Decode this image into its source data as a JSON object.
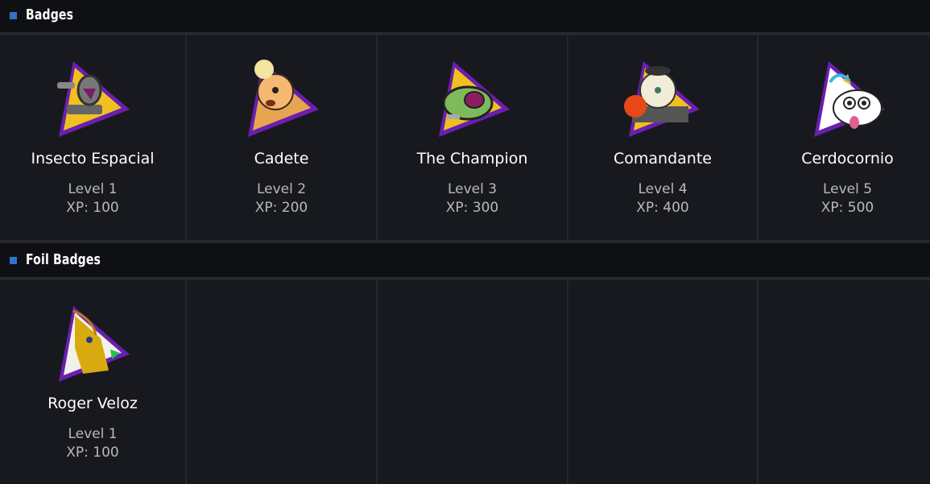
{
  "sections": [
    {
      "title": "Badges",
      "badges": [
        {
          "name": "Insecto Espacial",
          "level": "Level 1",
          "xp": "XP: 100",
          "icon": "alien-bug-badge-icon"
        },
        {
          "name": "Cadete",
          "level": "Level 2",
          "xp": "XP: 200",
          "icon": "pony-cadet-badge-icon"
        },
        {
          "name": "The Champion",
          "level": "Level 3",
          "xp": "XP: 300",
          "icon": "robot-head-badge-icon"
        },
        {
          "name": "Comandante",
          "level": "Level 4",
          "xp": "XP: 400",
          "icon": "pony-commander-badge-icon"
        },
        {
          "name": "Cerdocornio",
          "level": "Level 5",
          "xp": "XP: 500",
          "icon": "unicorn-pig-badge-icon"
        }
      ]
    },
    {
      "title": "Foil Badges",
      "badges": [
        {
          "name": "Roger Veloz",
          "level": "Level 1",
          "xp": "XP: 100",
          "icon": "foil-unicorn-badge-icon"
        }
      ]
    }
  ],
  "colors": {
    "accent": "#2f74c5",
    "triangle_fill": "#f0c020",
    "triangle_border": "#6a1fb0",
    "cell_bg": "#18191e",
    "header_bg": "#0f1014"
  }
}
